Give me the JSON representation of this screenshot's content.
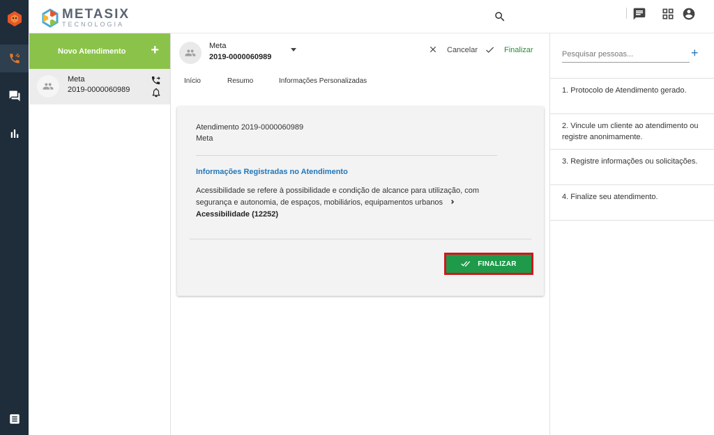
{
  "app": {
    "brand_name": "METASIX",
    "brand_sub": "TECNOLOGIA"
  },
  "rail": {
    "items": [
      {
        "icon": "phone-forward-icon"
      },
      {
        "icon": "chat-icon"
      },
      {
        "icon": "bar-chart-icon"
      },
      {
        "icon": "list-icon"
      }
    ]
  },
  "topbar": {
    "icons": [
      "search-icon",
      "message-icon",
      "grid-icon",
      "account-icon"
    ]
  },
  "sidebar": {
    "new_label": "Novo Atendimento",
    "new_plus": "+",
    "conversation": {
      "name": "Meta",
      "id": "2019-0000060989"
    }
  },
  "main": {
    "header": {
      "name": "Meta",
      "id": "2019-0000060989",
      "cancel_label": "Cancelar",
      "finish_label": "Finalizar"
    },
    "tabs": [
      {
        "label": "Início"
      },
      {
        "label": "Resumo"
      },
      {
        "label": "Informações Personalizadas"
      }
    ],
    "card": {
      "line1": "Atendimento 2019-0000060989",
      "line2": "Meta",
      "heading": "Informações Registradas no Atendimento",
      "body_text": "Acessibilidade se refere à possibilidade e condição de alcance para utilização, com segurança e autonomia, de espaços, mobiliários, equipamentos urbanos",
      "crumb": "Acessibilidade (12252)",
      "finalize_button": "FINALIZAR"
    }
  },
  "right_panel": {
    "search_placeholder": "Pesquisar pessoas...",
    "add_label": "+",
    "steps": [
      {
        "text": "1. Protocolo de Atendimento gerado."
      },
      {
        "text": "2. Vincule um cliente ao atendimento ou registre anonimamente."
      },
      {
        "text": "3. Registre informações ou solicitações."
      },
      {
        "text": "4. Finalize seu atendimento."
      }
    ]
  },
  "colors": {
    "rail_bg": "#1f2d3a",
    "new_button": "#8bc34a",
    "finalize_button": "#1e9a4a",
    "highlight_outline": "#d2161c",
    "link_blue": "#2176b8",
    "finish_green": "#2a8a3a"
  }
}
